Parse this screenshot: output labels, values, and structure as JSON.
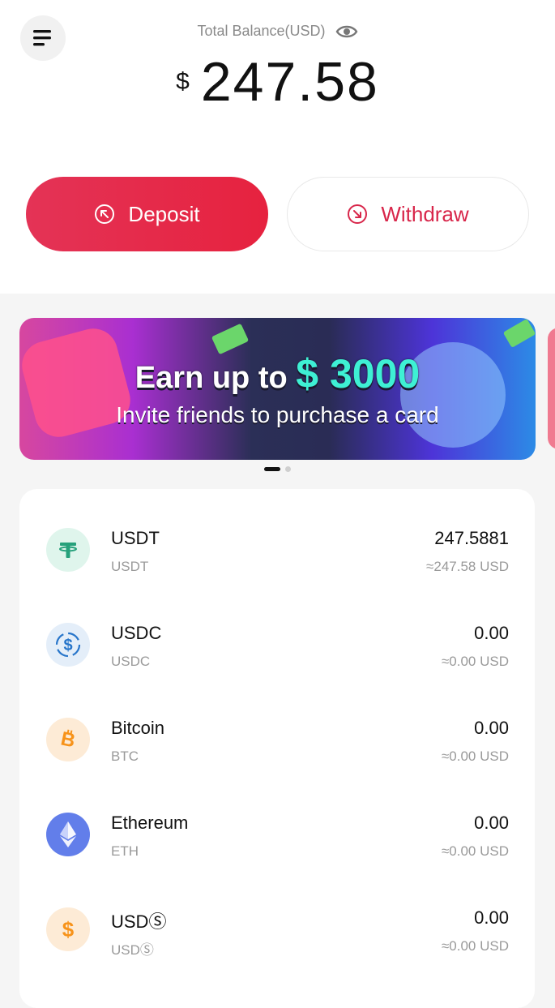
{
  "header": {
    "balance_label": "Total Balance(USD)",
    "currency_symbol": "$",
    "balance": "247.58"
  },
  "actions": {
    "deposit_label": "Deposit",
    "withdraw_label": "Withdraw"
  },
  "banner": {
    "title_prefix": "Earn up to",
    "title_amount": "$ 3000",
    "subtitle": "Invite friends to purchase a card",
    "page_count": 2,
    "active_page": 1
  },
  "assets": [
    {
      "name": "USDT",
      "symbol": "USDT",
      "amount": "247.5881",
      "usd": "≈247.58 USD",
      "icon": "tether-icon",
      "color": "#26a17b",
      "bg": "#dff5ec"
    },
    {
      "name": "USDC",
      "symbol": "USDC",
      "amount": "0.00",
      "usd": "≈0.00 USD",
      "icon": "usdc-icon",
      "color": "#2775ca",
      "bg": "#e4eef9"
    },
    {
      "name": "Bitcoin",
      "symbol": "BTC",
      "amount": "0.00",
      "usd": "≈0.00 USD",
      "icon": "bitcoin-icon",
      "color": "#f7931a",
      "bg": "#fdebd6"
    },
    {
      "name": "Ethereum",
      "symbol": "ETH",
      "amount": "0.00",
      "usd": "≈0.00 USD",
      "icon": "ethereum-icon",
      "color": "#627eea",
      "bg": "#627eea"
    },
    {
      "name": "USDⓈ",
      "symbol": "USDⓈ",
      "amount": "0.00",
      "usd": "≈0.00 USD",
      "icon": "dollar-coin-icon",
      "color": "#f7931a",
      "bg": "#fdebd6"
    }
  ],
  "colors": {
    "accent": "#e6223f",
    "withdraw_text": "#d8264a"
  }
}
